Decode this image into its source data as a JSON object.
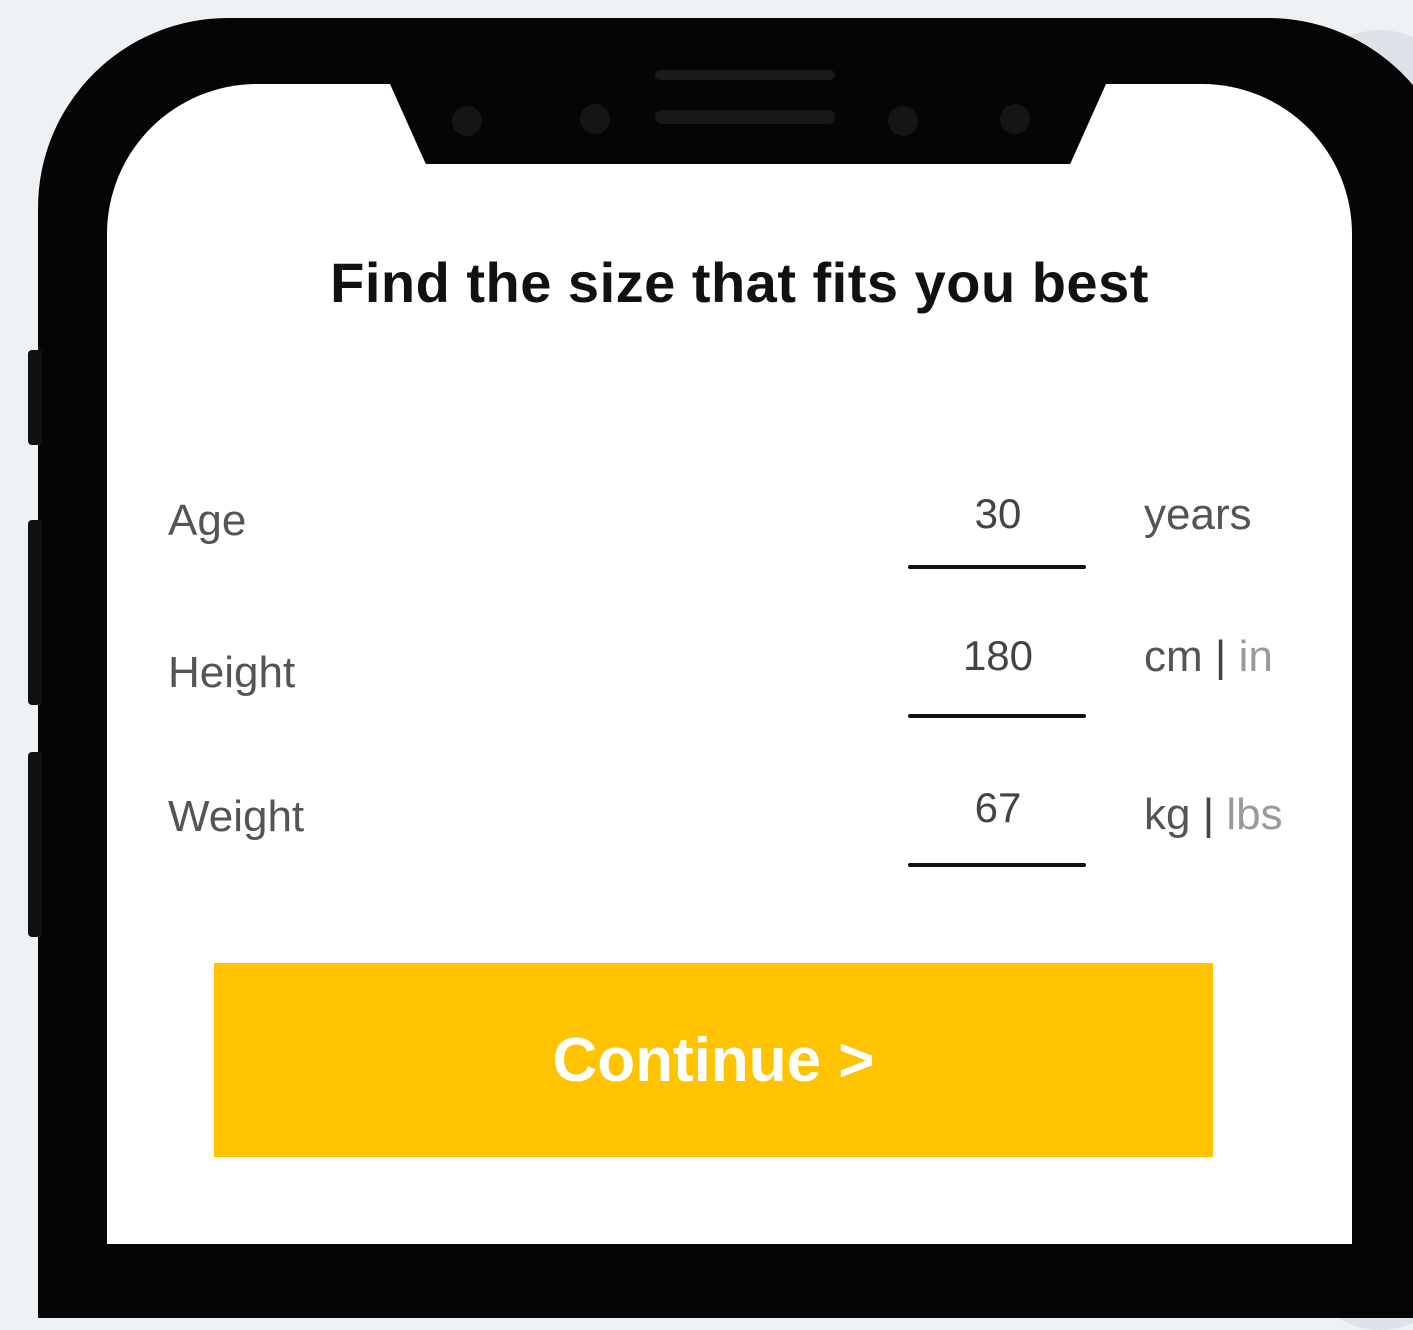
{
  "title": "Find the size that fits you best",
  "fields": [
    {
      "label": "Age",
      "value": "30",
      "unit": "years"
    },
    {
      "label": "Height",
      "value": "180",
      "unit_primary": "cm",
      "unit_separator": "|",
      "unit_secondary": "in"
    },
    {
      "label": "Weight",
      "value": "67",
      "unit_primary": "kg",
      "unit_separator": "|",
      "unit_secondary": "lbs"
    }
  ],
  "continue_label": "Continue >",
  "colors": {
    "accent": "#FFC300",
    "background": "#EEF2F5",
    "phone_frame": "#050505"
  }
}
